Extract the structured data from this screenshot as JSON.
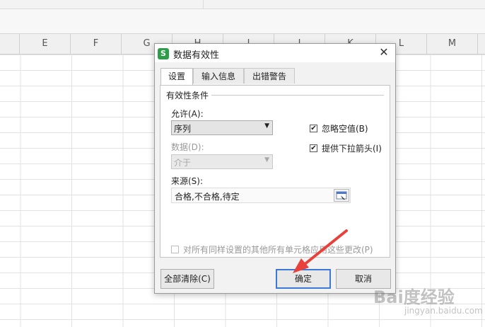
{
  "spreadsheet": {
    "columns": [
      "E",
      "F",
      "G",
      "H",
      "I",
      "J",
      "K",
      "L",
      "M"
    ]
  },
  "dialog": {
    "title": "数据有效性",
    "close_icon": "close-icon",
    "tabs": [
      {
        "label": "设置",
        "active": true
      },
      {
        "label": "输入信息",
        "active": false
      },
      {
        "label": "出错警告",
        "active": false
      }
    ],
    "section_title": "有效性条件",
    "allow_label": "允许(A):",
    "allow_value": "序列",
    "data_label": "数据(D):",
    "data_value": "介于",
    "ignore_blank_label": "忽略空值(B)",
    "ignore_blank_checked": true,
    "dropdown_arrow_label": "提供下拉箭头(I)",
    "dropdown_arrow_checked": true,
    "source_label": "来源(S):",
    "source_value": "合格,不合格,待定",
    "apply_all_label": "对所有同样设置的其他所有单元格应用这些更改(P)",
    "apply_all_checked": false,
    "clear_all_button": "全部清除(C)",
    "ok_button": "确定",
    "cancel_button": "取消"
  },
  "annotation": {
    "color": "#e8403a"
  },
  "watermark": {
    "main": "Bai度经验",
    "sub": "jingyan.baidu.com"
  }
}
